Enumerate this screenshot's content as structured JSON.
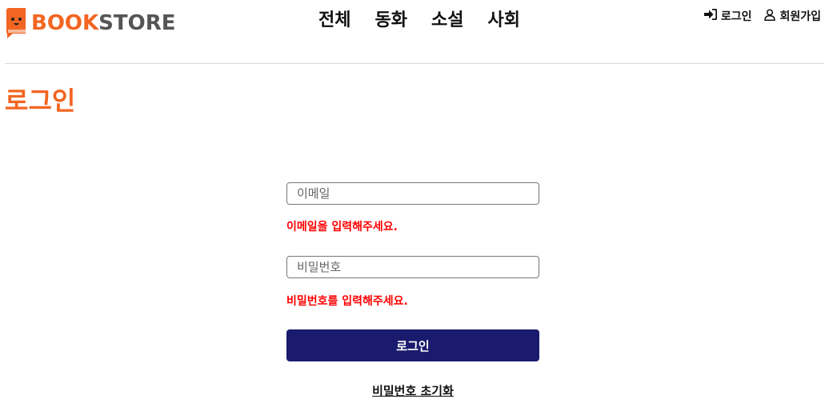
{
  "brand": {
    "logo_book": "BOOK",
    "logo_store": "STORE",
    "accent_color": "#f26522",
    "logo_icon": "book-face-icon"
  },
  "nav": {
    "items": [
      "전체",
      "동화",
      "소설",
      "사회"
    ]
  },
  "user_menu": {
    "login_label": "로그인",
    "login_icon": "sign-in-icon",
    "signup_label": "회원가입",
    "signup_icon": "user-icon"
  },
  "page": {
    "title": "로그인"
  },
  "form": {
    "email_placeholder": "이메일",
    "email_error": "이메일을 입력해주세요.",
    "password_placeholder": "비밀번호",
    "password_error": "비밀번호를 입력해주세요.",
    "submit_label": "로그인",
    "submit_color": "#1a1a6e",
    "error_color": "#ff0000",
    "reset_link": "비밀번호 초기화"
  }
}
